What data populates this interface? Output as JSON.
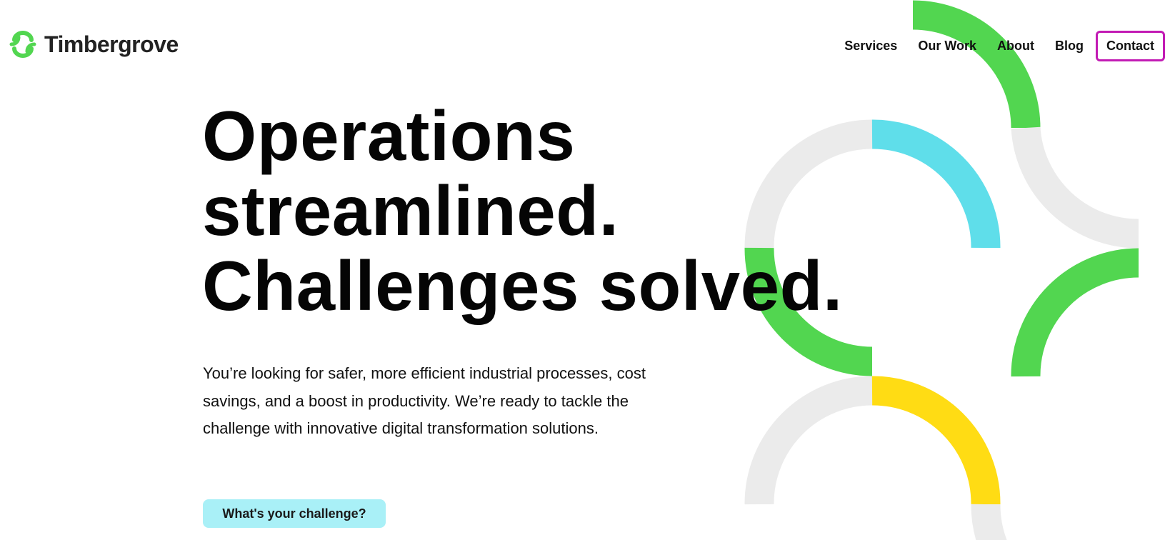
{
  "brand": {
    "name": "Timbergrove",
    "logo_icon": "timbergrove-mark-icon"
  },
  "nav": {
    "items": [
      {
        "label": "Services"
      },
      {
        "label": "Our Work"
      },
      {
        "label": "About"
      },
      {
        "label": "Blog"
      }
    ],
    "contact_label": "Contact"
  },
  "hero": {
    "headline_lines": [
      "Operations",
      "streamlined.",
      "Challenges solved."
    ],
    "lede": "You’re looking for safer, more efficient industrial processes, cost savings, and a boost in productivity. We’re ready to tackle the challenge with innovative digital transformation solutions.",
    "cta_label": "What's your challenge?"
  },
  "colors": {
    "brand_green": "#52d650",
    "accent_cyan": "#5fdeea",
    "accent_yellow": "#ffdc14",
    "arc_gray": "#ebebeb",
    "contact_border": "#c21bb4",
    "cta_bg": "#a9f0f7"
  }
}
